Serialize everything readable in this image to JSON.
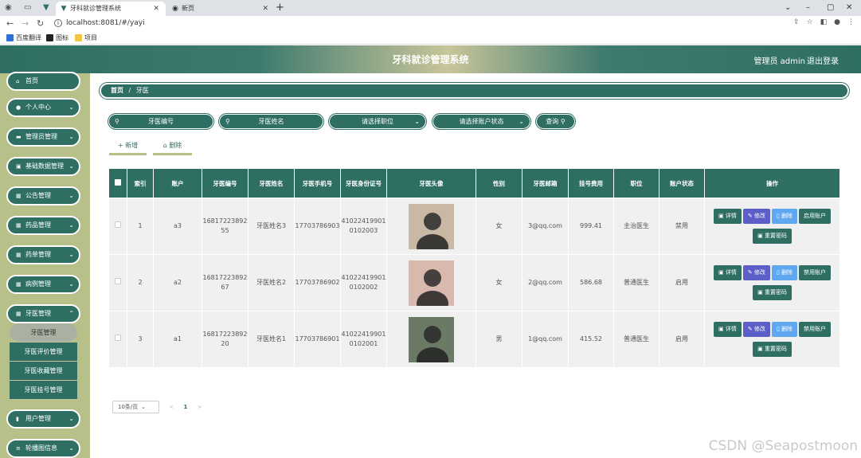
{
  "browser": {
    "tabs": [
      {
        "title": "牙科就诊管理系统",
        "icon": "vue-logo-icon"
      },
      {
        "title": "新页",
        "icon": "globe-icon"
      }
    ],
    "url": "localhost:8081/#/yayi",
    "bookmarks": [
      "百度翻译",
      "图标",
      "项目"
    ]
  },
  "header": {
    "title": "牙科就诊管理系统",
    "user": "管理员 admin",
    "logout": "退出登录"
  },
  "sidebar": {
    "items": [
      {
        "label": "首页",
        "icon": "home-icon"
      },
      {
        "label": "个人中心",
        "icon": "user-icon"
      },
      {
        "label": "管理员管理",
        "icon": "card-icon"
      },
      {
        "label": "基础数据管理",
        "icon": "card-icon"
      },
      {
        "label": "公告管理",
        "icon": "grid-icon"
      },
      {
        "label": "药品管理",
        "icon": "grid-icon"
      },
      {
        "label": "药单管理",
        "icon": "grid-icon"
      },
      {
        "label": "病例管理",
        "icon": "grid-icon"
      },
      {
        "label": "牙医管理",
        "icon": "grid-icon"
      },
      {
        "label": "用户管理",
        "icon": "doc-icon"
      },
      {
        "label": "轮播图信息",
        "icon": "list-icon"
      }
    ],
    "submenu": [
      "牙医管理",
      "牙医评价管理",
      "牙医收藏管理",
      "牙医挂号管理"
    ]
  },
  "breadcrumb": {
    "home": "首页",
    "sep": "/",
    "current": "牙医"
  },
  "filters": {
    "no_placeholder": "牙医编号",
    "name_placeholder": "牙医姓名",
    "title_placeholder": "请选择职位",
    "status_placeholder": "请选择账户状态",
    "query": "查询"
  },
  "actions": {
    "add": "+ 新增",
    "delete": "删除"
  },
  "table": {
    "headers": [
      "索引",
      "账户",
      "牙医编号",
      "牙医姓名",
      "牙医手机号",
      "牙医身份证号",
      "牙医头像",
      "性别",
      "牙医邮箱",
      "挂号费用",
      "职位",
      "账户状态",
      "操作"
    ],
    "rows": [
      {
        "index": "1",
        "account": "a3",
        "no": "1681722389255",
        "name": "牙医姓名3",
        "phone": "17703786903",
        "idcard": "410224199010102003",
        "gender": "女",
        "email": "3@qq.com",
        "fee": "999.41",
        "title": "主治医生",
        "status": "禁用",
        "toggle": "启用账户",
        "avatar_color": "#c9b9a4"
      },
      {
        "index": "2",
        "account": "a2",
        "no": "1681722389267",
        "name": "牙医姓名2",
        "phone": "17703786902",
        "idcard": "410224199010102002",
        "gender": "女",
        "email": "2@qq.com",
        "fee": "586.68",
        "title": "普通医生",
        "status": "启用",
        "toggle": "禁用账户",
        "avatar_color": "#d9b8ad"
      },
      {
        "index": "3",
        "account": "a1",
        "no": "1681722389220",
        "name": "牙医姓名1",
        "phone": "17703786901",
        "idcard": "410224199010102001",
        "gender": "男",
        "email": "1@qq.com",
        "fee": "415.52",
        "title": "普通医生",
        "status": "启用",
        "toggle": "禁用账户",
        "avatar_color": "#6b7a64"
      }
    ],
    "op_detail": "详情",
    "op_edit": "修改",
    "op_delete": "删除",
    "op_reset": "重置密码"
  },
  "pager": {
    "size": "10条/页",
    "prev": "<",
    "page": "1",
    "next": ">"
  },
  "watermark": "CSDN @Seapostmoon"
}
